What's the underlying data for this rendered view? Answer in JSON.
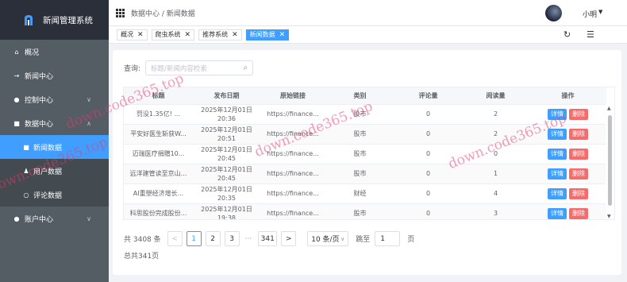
{
  "app": {
    "title": "新闻管理系统"
  },
  "sidebar": {
    "items": [
      {
        "icon": "home-icon",
        "glyph": "⌂",
        "label": "概况"
      },
      {
        "icon": "arrow-right-icon",
        "glyph": "→",
        "label": "新闻中心"
      },
      {
        "icon": "circle-icon",
        "glyph": "●",
        "label": "控制中心",
        "chevron": "∨"
      },
      {
        "icon": "book-icon",
        "glyph": "■",
        "label": "数据中心",
        "chevron": "∧"
      }
    ],
    "sub_items": [
      {
        "icon": "doc-icon",
        "glyph": "■",
        "label": "新闻数据",
        "active": true
      },
      {
        "icon": "users-icon",
        "glyph": "♟",
        "label": "用户数据"
      },
      {
        "icon": "comment-icon",
        "glyph": "○",
        "label": "评论数据"
      }
    ],
    "account": {
      "icon": "account-icon",
      "glyph": "●",
      "label": "账户中心",
      "chevron": "∨"
    }
  },
  "header": {
    "breadcrumb": "数据中心 / 新闻数据",
    "user_name": "小明",
    "caret": "▼"
  },
  "tags": [
    {
      "label": "概况",
      "close": "✕"
    },
    {
      "label": "爬虫系统",
      "close": "✕"
    },
    {
      "label": "推荐系统",
      "close": "✕"
    },
    {
      "label": "新闻数据",
      "close": "✕",
      "active": true
    }
  ],
  "toolbar": {
    "refresh_glyph": "↻",
    "settings_glyph": "☰"
  },
  "search": {
    "label": "查询:",
    "placeholder": "标题/新闻内容检索",
    "icon_glyph": "⌕"
  },
  "table": {
    "headers": [
      "标题",
      "发布日期",
      "原始链接",
      "类别",
      "评论量",
      "阅读量",
      "操作"
    ],
    "rows": [
      {
        "title": "罚没1.35亿! ...",
        "date": "2025年12月01日 20:36",
        "link": "https://finance...",
        "category": "股市",
        "comments": "0",
        "reads": "2"
      },
      {
        "title": "平安好医生斩获W...",
        "date": "2025年12月01日 20:51",
        "link": "https://finance...",
        "category": "股市",
        "comments": "0",
        "reads": "2"
      },
      {
        "title": "迈瑞医疗捐赠10...",
        "date": "2025年12月01日 20:45",
        "link": "https://finance...",
        "category": "股市",
        "comments": "0",
        "reads": "0"
      },
      {
        "title": "远洋建管读至京山...",
        "date": "2025年12月01日 20:45",
        "link": "https://finance...",
        "category": "股市",
        "comments": "0",
        "reads": "1"
      },
      {
        "title": "AI重塑经济增长...",
        "date": "2025年12月01日 20:35",
        "link": "https://finance...",
        "category": "财经",
        "comments": "0",
        "reads": "4"
      },
      {
        "title": "科思股份完成股份...",
        "date": "2025年12月01日 19:38",
        "link": "https://finance...",
        "category": "股市",
        "comments": "0",
        "reads": "3"
      }
    ],
    "detail_label": "详情",
    "delete_label": "删除"
  },
  "pagination": {
    "total": "共 3408 条",
    "prev": "<",
    "pages": [
      "1",
      "2",
      "3"
    ],
    "ellipsis": "···",
    "last": "341",
    "next": ">",
    "page_size": "10 条/页",
    "size_caret": "∨",
    "jump_label": "跳至",
    "jump_value": "1",
    "page_unit": "页",
    "total_pages": "总共341页"
  },
  "watermarks": [
    "down.code365.top",
    "down.code365.top",
    "down.code365.top",
    "down.code365.top"
  ],
  "colors": {
    "accent": "#409eff",
    "danger": "#f56c6c",
    "sidebar": "#545c64"
  }
}
